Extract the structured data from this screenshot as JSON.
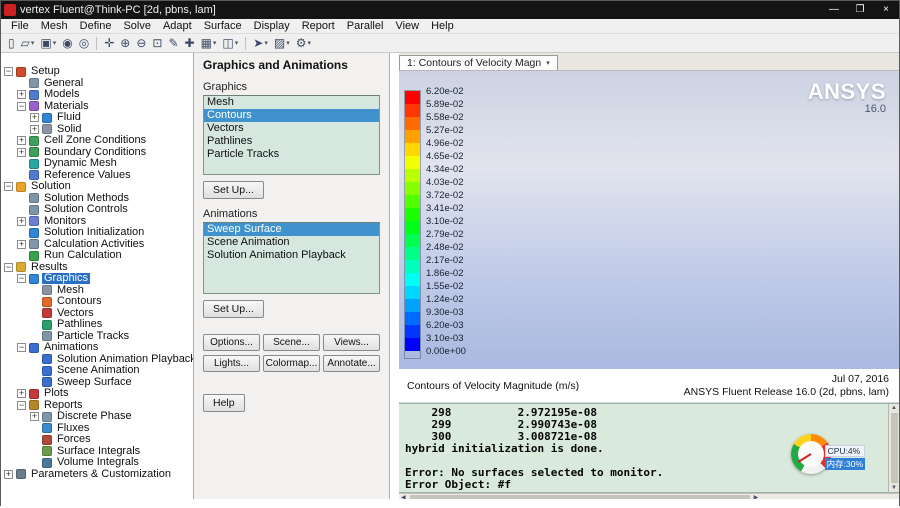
{
  "window": {
    "title": "vertex Fluent@Think-PC  [2d, pbns, lam]",
    "minimize": "—",
    "maximize": "❐",
    "close": "×"
  },
  "menu": [
    "File",
    "Mesh",
    "Define",
    "Solve",
    "Adapt",
    "Surface",
    "Display",
    "Report",
    "Parallel",
    "View",
    "Help"
  ],
  "toolbar": [
    {
      "name": "journal-icon",
      "glyph": "▯"
    },
    {
      "name": "open-file-icon",
      "glyph": "▱",
      "dd": true
    },
    {
      "name": "save-icon",
      "glyph": "▣",
      "dd": true
    },
    {
      "name": "help-icon",
      "glyph": "◉"
    },
    {
      "name": "web-help-icon",
      "glyph": "◎"
    },
    {
      "sep": true
    },
    {
      "name": "pan-icon",
      "glyph": "✛"
    },
    {
      "name": "zoom-in-icon",
      "glyph": "⊕"
    },
    {
      "name": "zoom-out-icon",
      "glyph": "⊖"
    },
    {
      "name": "zoom-fit-icon",
      "glyph": "⊡"
    },
    {
      "name": "probe-icon",
      "glyph": "✎"
    },
    {
      "name": "measure-icon",
      "glyph": "✚"
    },
    {
      "name": "mesh-display-icon",
      "glyph": "▦",
      "dd": true
    },
    {
      "name": "display-options-icon",
      "glyph": "◫",
      "dd": true
    },
    {
      "sep": true
    },
    {
      "name": "vector-display-icon",
      "glyph": "➤",
      "dd": true
    },
    {
      "name": "palette-icon",
      "glyph": "▨",
      "dd": true
    },
    {
      "name": "settings-icon",
      "glyph": "⚙",
      "dd": true
    }
  ],
  "tree": [
    {
      "label": "Setup",
      "d": 0,
      "x": "minus",
      "icon": "setup"
    },
    {
      "label": "General",
      "d": 1,
      "x": "none",
      "icon": "general"
    },
    {
      "label": "Models",
      "d": 1,
      "x": "plus",
      "icon": "models"
    },
    {
      "label": "Materials",
      "d": 1,
      "x": "minus",
      "icon": "materials"
    },
    {
      "label": "Fluid",
      "d": 2,
      "x": "plus",
      "icon": "fluid"
    },
    {
      "label": "Solid",
      "d": 2,
      "x": "plus",
      "icon": "solid"
    },
    {
      "label": "Cell Zone Conditions",
      "d": 1,
      "x": "plus",
      "icon": "cell-zones"
    },
    {
      "label": "Boundary Conditions",
      "d": 1,
      "x": "plus",
      "icon": "boundary"
    },
    {
      "label": "Dynamic Mesh",
      "d": 1,
      "x": "none",
      "icon": "dynamic-mesh"
    },
    {
      "label": "Reference Values",
      "d": 1,
      "x": "none",
      "icon": "reference-values"
    },
    {
      "label": "Solution",
      "d": 0,
      "x": "minus",
      "icon": "solution"
    },
    {
      "label": "Solution Methods",
      "d": 1,
      "x": "none",
      "icon": "general"
    },
    {
      "label": "Solution Controls",
      "d": 1,
      "x": "none",
      "icon": "general"
    },
    {
      "label": "Monitors",
      "d": 1,
      "x": "plus",
      "icon": "monitors"
    },
    {
      "label": "Solution Initialization",
      "d": 1,
      "x": "none",
      "icon": "solution-init"
    },
    {
      "label": "Calculation Activities",
      "d": 1,
      "x": "plus",
      "icon": "general"
    },
    {
      "label": "Run Calculation",
      "d": 1,
      "x": "none",
      "icon": "run-calc"
    },
    {
      "label": "Results",
      "d": 0,
      "x": "minus",
      "icon": "results"
    },
    {
      "label": "Graphics",
      "d": 1,
      "x": "minus",
      "icon": "graphics",
      "sel": true
    },
    {
      "label": "Mesh",
      "d": 2,
      "x": "none",
      "icon": "solid"
    },
    {
      "label": "Contours",
      "d": 2,
      "x": "none",
      "icon": "contours"
    },
    {
      "label": "Vectors",
      "d": 2,
      "x": "none",
      "icon": "vectors"
    },
    {
      "label": "Pathlines",
      "d": 2,
      "x": "none",
      "icon": "pathlines"
    },
    {
      "label": "Particle Tracks",
      "d": 2,
      "x": "none",
      "icon": "general"
    },
    {
      "label": "Animations",
      "d": 1,
      "x": "minus",
      "icon": "animations"
    },
    {
      "label": "Solution Animation Playback",
      "d": 2,
      "x": "none",
      "icon": "anim-playback"
    },
    {
      "label": "Scene Animation",
      "d": 2,
      "x": "none",
      "icon": "scene-anim"
    },
    {
      "label": "Sweep Surface",
      "d": 2,
      "x": "none",
      "icon": "sweep-surface"
    },
    {
      "label": "Plots",
      "d": 1,
      "x": "plus",
      "icon": "plots"
    },
    {
      "label": "Reports",
      "d": 1,
      "x": "minus",
      "icon": "reports"
    },
    {
      "label": "Discrete Phase",
      "d": 2,
      "x": "plus",
      "icon": "general"
    },
    {
      "label": "Fluxes",
      "d": 2,
      "x": "none",
      "icon": "fluxes"
    },
    {
      "label": "Forces",
      "d": 2,
      "x": "none",
      "icon": "forces"
    },
    {
      "label": "Surface Integrals",
      "d": 2,
      "x": "none",
      "icon": "surface-integrals"
    },
    {
      "label": "Volume Integrals",
      "d": 2,
      "x": "none",
      "icon": "volume-integrals"
    },
    {
      "label": "Parameters & Customization",
      "d": 0,
      "x": "plus",
      "icon": "parameters"
    }
  ],
  "task_page": {
    "title": "Graphics and Animations",
    "graphics_label": "Graphics",
    "graphics_items": [
      "Mesh",
      "Contours",
      "Vectors",
      "Pathlines",
      "Particle Tracks"
    ],
    "graphics_selected": "Contours",
    "setup_button": "Set Up...",
    "animations_label": "Animations",
    "animations_items": [
      "Sweep Surface",
      "Scene Animation",
      "Solution Animation Playback"
    ],
    "animations_selected": "Sweep Surface",
    "setup2_button": "Set Up...",
    "buttons": [
      "Options...",
      "Scene...",
      "Views...",
      "Lights...",
      "Colormap...",
      "Annotate..."
    ],
    "help_button": "Help"
  },
  "viewport": {
    "tab_label": "1: Contours of Velocity Magn",
    "tab_dropdown": "▾",
    "logo": "ANSYS",
    "logo_version": "16.0",
    "legend_values": [
      "6.20e-02",
      "5.89e-02",
      "5.58e-02",
      "5.27e-02",
      "4.96e-02",
      "4.65e-02",
      "4.34e-02",
      "4.03e-02",
      "3.72e-02",
      "3.41e-02",
      "3.10e-02",
      "2.79e-02",
      "2.48e-02",
      "2.17e-02",
      "1.86e-02",
      "1.55e-02",
      "1.24e-02",
      "9.30e-03",
      "6.20e-03",
      "3.10e-03",
      "0.00e+00"
    ],
    "caption": "Contours of Velocity Magnitude (m/s)",
    "date": "Jul 07, 2016",
    "release": "ANSYS Fluent Release 16.0 (2d, pbns, lam)"
  },
  "console": {
    "lines": [
      "    298          2.972195e-08",
      "    299          2.990743e-08",
      "    300          3.008721e-08",
      "hybrid initialization is done.",
      "",
      "Error: No surfaces selected to monitor.",
      "Error Object: #f"
    ]
  },
  "monitor": {
    "cpu": "CPU:4%",
    "memory": "内存:30%"
  },
  "scrollbar": {
    "up": "▲",
    "down": "▼",
    "left": "◀",
    "right": "▶"
  }
}
